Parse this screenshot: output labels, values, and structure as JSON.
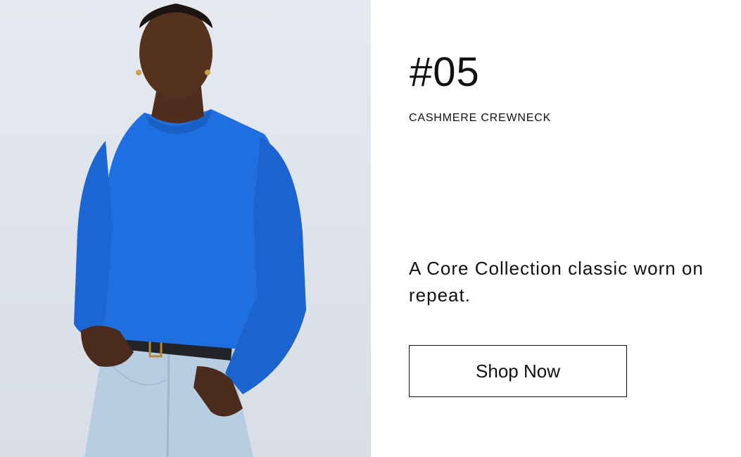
{
  "hero": {
    "image_alt": "Model wearing blue cashmere crewneck sweater and light-wash jeans"
  },
  "product": {
    "number": "#05",
    "name": "CASHMERE CREWNECK",
    "tagline": "A Core Collection classic worn on repeat."
  },
  "cta": {
    "label": "Shop Now"
  },
  "colors": {
    "sweater": "#1f6fe0",
    "background_photo": "#e2e6ed",
    "text": "#111111",
    "panel": "#ffffff"
  }
}
